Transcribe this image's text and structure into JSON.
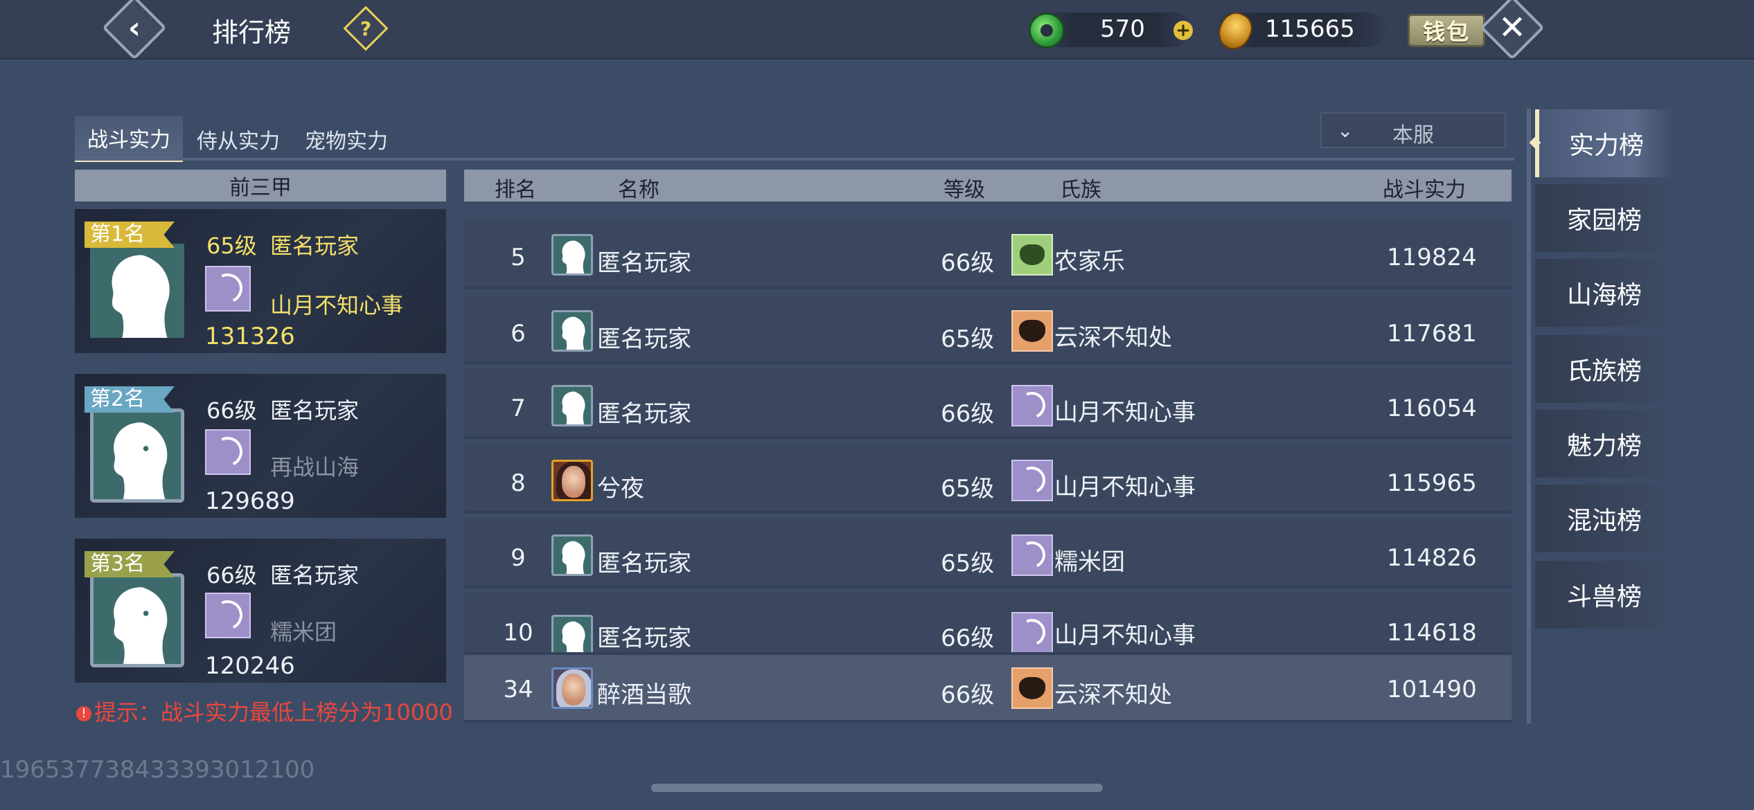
{
  "header": {
    "back_icon": "chevron-left-icon",
    "title": "排行榜",
    "help_icon": "question-icon",
    "jade_amount": "570",
    "gold_amount": "115665",
    "wallet_label": "钱包",
    "close_icon": "close-icon"
  },
  "tabs": [
    {
      "label": "战斗实力",
      "active": true
    },
    {
      "label": "侍从实力",
      "active": false
    },
    {
      "label": "宠物实力",
      "active": false
    }
  ],
  "server_select": {
    "value": "本服"
  },
  "top3": {
    "header": "前三甲",
    "cards": [
      {
        "rank_label": "第1名",
        "level": "65级",
        "name": "匿名玩家",
        "clan": "山月不知心事",
        "power": "131326"
      },
      {
        "rank_label": "第2名",
        "level": "66级",
        "name": "匿名玩家",
        "clan": "再战山海",
        "power": "129689"
      },
      {
        "rank_label": "第3名",
        "level": "66级",
        "name": "匿名玩家",
        "clan": "糯米团",
        "power": "120246"
      }
    ]
  },
  "table": {
    "columns": {
      "rank": "排名",
      "name": "名称",
      "level": "等级",
      "clan": "氏族",
      "power": "战斗实力"
    },
    "rows": [
      {
        "rank": "5",
        "name": "匿名玩家",
        "level": "66级",
        "clan": "农家乐",
        "power": "119824"
      },
      {
        "rank": "6",
        "name": "匿名玩家",
        "level": "65级",
        "clan": "云深不知处",
        "power": "117681"
      },
      {
        "rank": "7",
        "name": "匿名玩家",
        "level": "66级",
        "clan": "山月不知心事",
        "power": "116054"
      },
      {
        "rank": "8",
        "name": "兮夜",
        "level": "65级",
        "clan": "山月不知心事",
        "power": "115965"
      },
      {
        "rank": "9",
        "name": "匿名玩家",
        "level": "65级",
        "clan": "糯米团",
        "power": "114826"
      },
      {
        "rank": "10",
        "name": "匿名玩家",
        "level": "66级",
        "clan": "山月不知心事",
        "power": "114618"
      }
    ],
    "self_row": {
      "rank": "34",
      "name": "醉酒当歌",
      "level": "66级",
      "clan": "云深不知处",
      "power": "101490"
    }
  },
  "hint": "提示：战斗实力最低上榜分为10000",
  "uid": "196537738433393012100",
  "side_menu": [
    {
      "label": "实力榜",
      "active": true
    },
    {
      "label": "家园榜",
      "active": false
    },
    {
      "label": "山海榜",
      "active": false
    },
    {
      "label": "氏族榜",
      "active": false
    },
    {
      "label": "魅力榜",
      "active": false
    },
    {
      "label": "混沌榜",
      "active": false
    },
    {
      "label": "斗兽榜",
      "active": false
    }
  ],
  "colors": {
    "background": "#3c4c66",
    "gold_text": "#f3e06a",
    "rank1_ribbon": "#d8b93a",
    "rank2_ribbon": "#6aa7c2",
    "rank3_ribbon": "#9aa14a",
    "hint_red": "#e9473d"
  }
}
